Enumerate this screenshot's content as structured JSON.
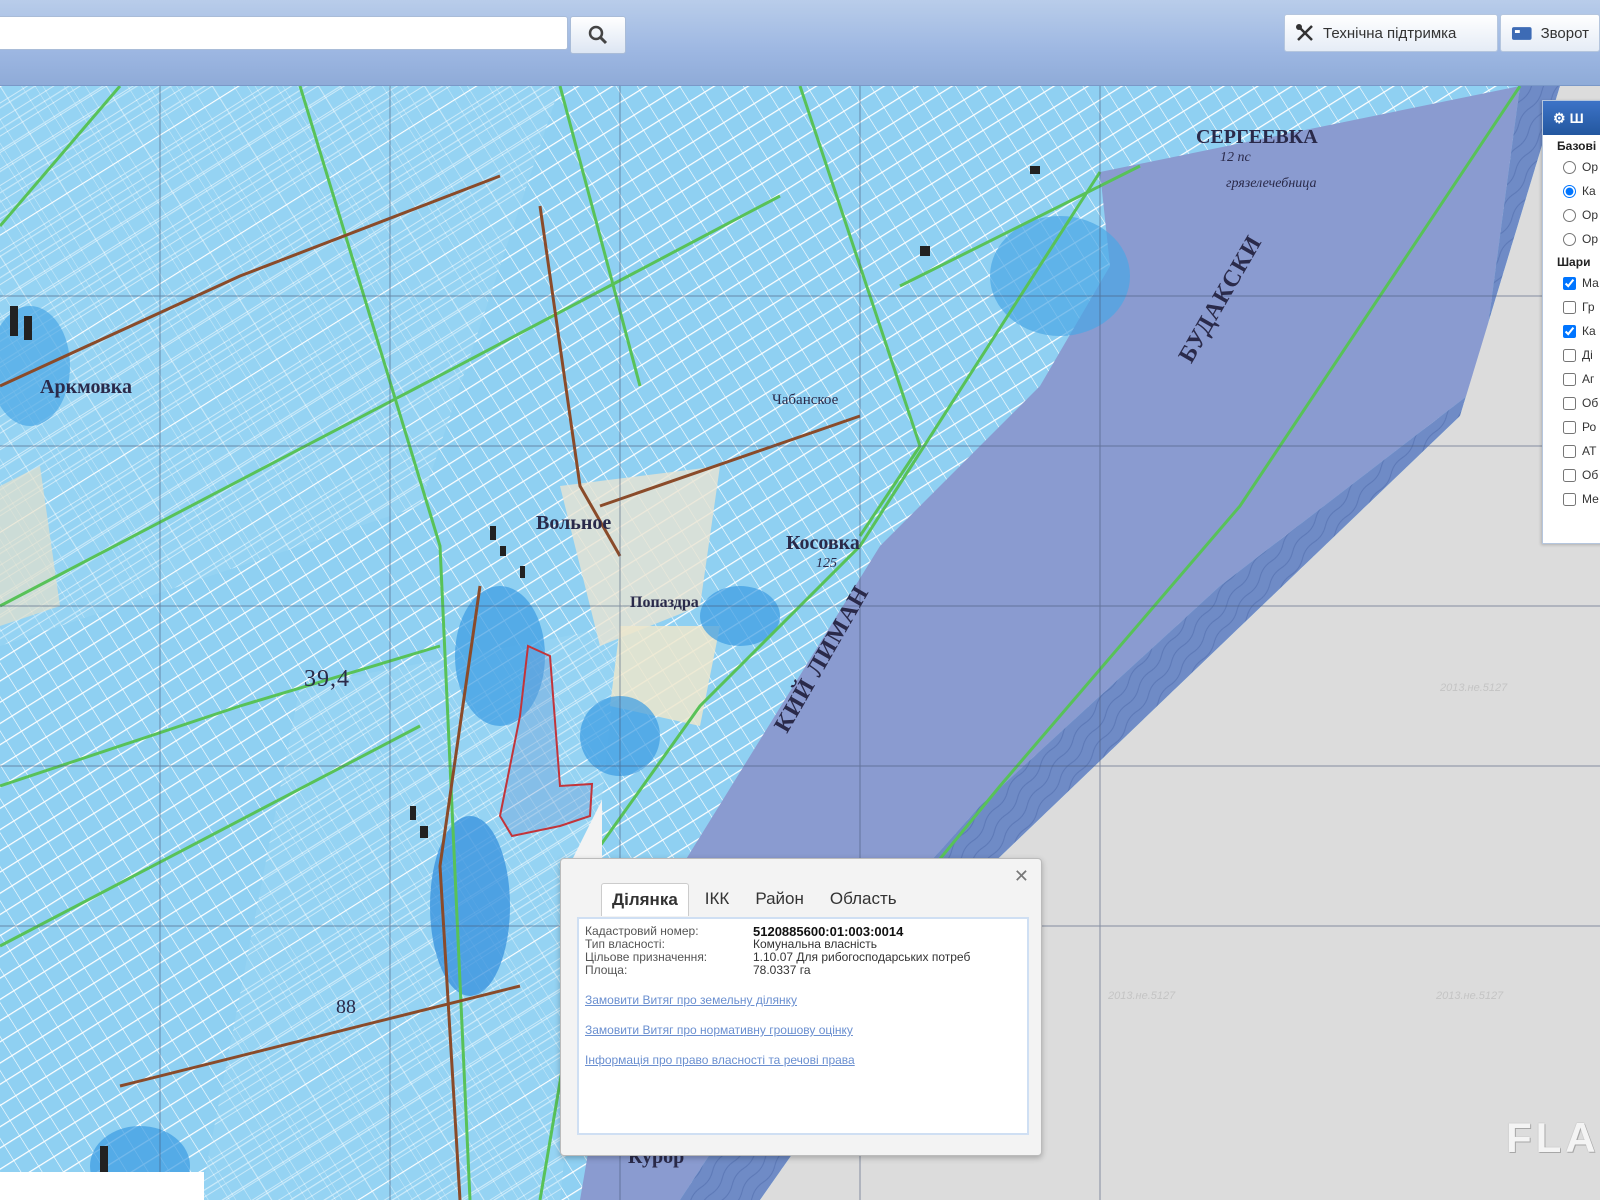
{
  "search": {
    "placeholder": "",
    "value": ""
  },
  "header": {
    "support_label": "Технічна підтримка",
    "feedback_label": "Зворот"
  },
  "layers": {
    "title": "Ш",
    "base_group": "Базові",
    "overlay_group": "Шари",
    "base_items": [
      {
        "label": "Ор",
        "selected": false
      },
      {
        "label": "Ка",
        "selected": true
      },
      {
        "label": "Ор",
        "selected": false
      },
      {
        "label": "Ор",
        "selected": false
      }
    ],
    "overlay_items": [
      {
        "label": "Ма",
        "checked": true
      },
      {
        "label": "Гр",
        "checked": false
      },
      {
        "label": "Ка",
        "checked": true
      },
      {
        "label": "Ді",
        "checked": false
      },
      {
        "label": "Аг",
        "checked": false
      },
      {
        "label": "Об",
        "checked": false
      },
      {
        "label": "Ро",
        "checked": false
      },
      {
        "label": "АТ",
        "checked": false
      },
      {
        "label": "Об",
        "checked": false
      },
      {
        "label": "Ме",
        "checked": false
      }
    ]
  },
  "map_labels": {
    "sergeevka": "СЕРГЕЕВКА",
    "sergeevka_sub": "12 пс",
    "mud_bath": "грязелечебница",
    "budak": "БУДАКСКИ",
    "liman": "КИЙ ЛИМАН",
    "kosovka": "Косовка",
    "kosovka_sub": "125",
    "volnoe": "Вольное",
    "popazdra": "Попаздра",
    "chabanskoe": "Чабанское",
    "arkovka": "Аркмовка",
    "elev_394": "39,4",
    "elev_88": "88",
    "kurort": "Курор",
    "watermark": "2013.не.5127"
  },
  "popup": {
    "tabs": [
      "Ділянка",
      "ІКК",
      "Район",
      "Область"
    ],
    "active_tab": "Ділянка",
    "fields": [
      {
        "key": "Кадастровий номер:",
        "value": "5120885600:01:003:0014"
      },
      {
        "key": "Тип власності:",
        "value": "Комунальна власність"
      },
      {
        "key": "Цільове призначення:",
        "value": "1.10.07 Для рибогосподарських потреб"
      },
      {
        "key": "Площа:",
        "value": "78.0337 га"
      }
    ],
    "links": [
      "Замовити Витяг про земельну ділянку",
      "Замовити Витяг про нормативну грошову оцінку",
      "Інформація про право власності та речові права"
    ]
  },
  "flash_logo": "FLA"
}
